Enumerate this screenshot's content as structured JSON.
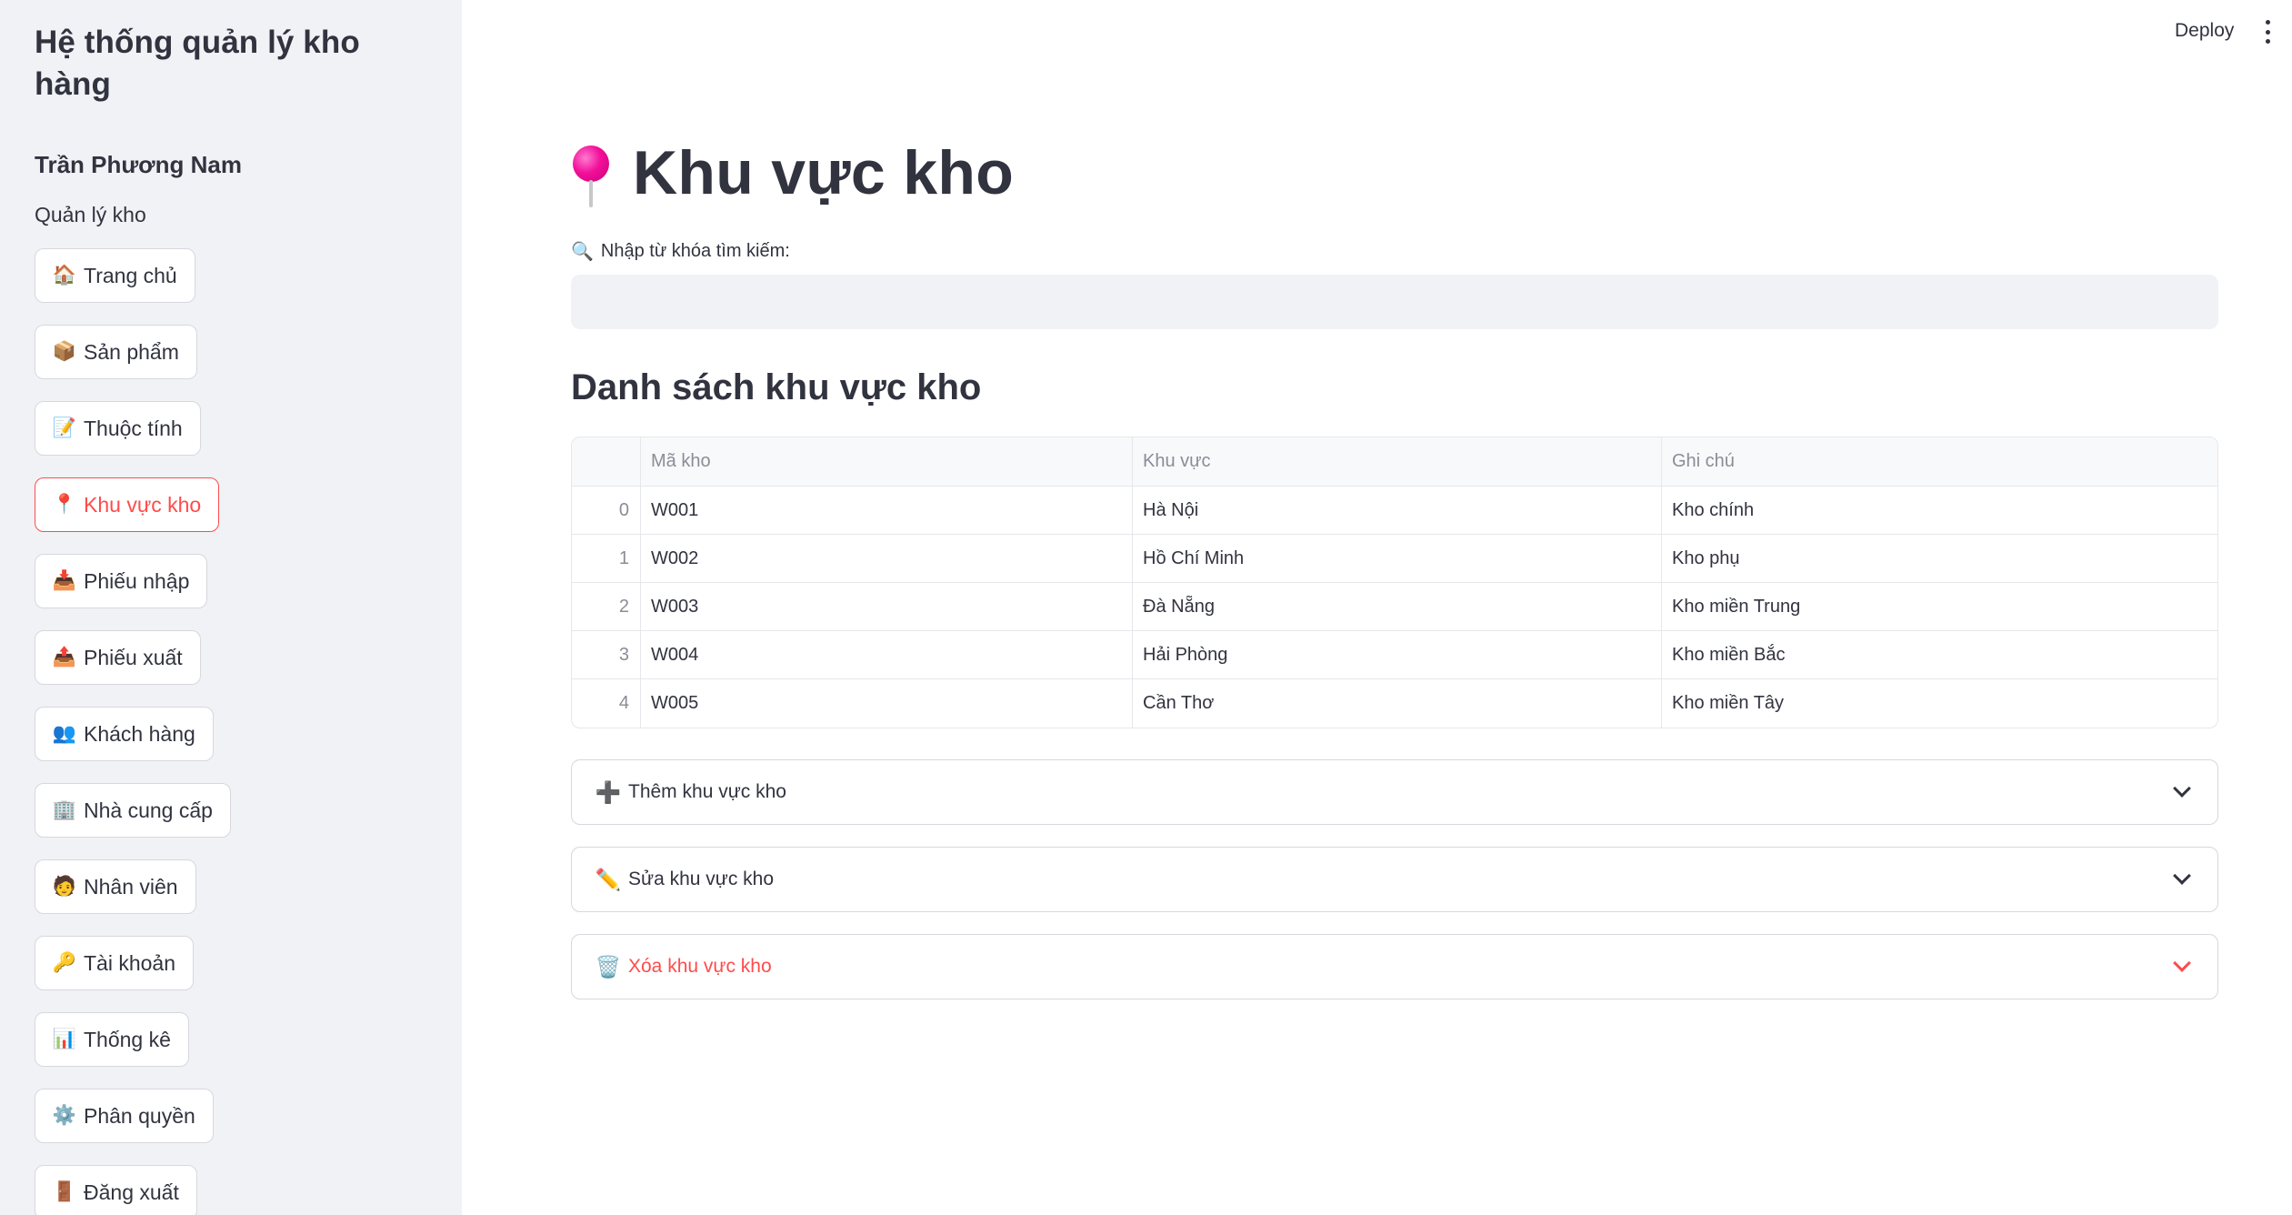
{
  "sidebar": {
    "app_title": "Hệ thống quản lý kho hàng",
    "user_name": "Trần Phương Nam",
    "section_label": "Quản lý kho",
    "items": [
      {
        "icon": "house-icon",
        "emoji": "🏠",
        "label": "Trang chủ"
      },
      {
        "icon": "package-icon",
        "emoji": "📦",
        "label": "Sản phẩm"
      },
      {
        "icon": "memo-icon",
        "emoji": "📝",
        "label": "Thuộc tính"
      },
      {
        "icon": "pushpin-icon",
        "emoji": "📍",
        "label": "Khu vực kho",
        "active": true
      },
      {
        "icon": "inbox-tray-icon",
        "emoji": "📥",
        "label": "Phiếu nhập"
      },
      {
        "icon": "outbox-tray-icon",
        "emoji": "📤",
        "label": "Phiếu xuất"
      },
      {
        "icon": "people-icon",
        "emoji": "👥",
        "label": "Khách hàng"
      },
      {
        "icon": "office-building-icon",
        "emoji": "🏢",
        "label": "Nhà cung cấp"
      },
      {
        "icon": "person-icon",
        "emoji": "🧑",
        "label": "Nhân viên"
      },
      {
        "icon": "key-icon",
        "emoji": "🔑",
        "label": "Tài khoản"
      },
      {
        "icon": "bar-chart-icon",
        "emoji": "📊",
        "label": "Thống kê"
      },
      {
        "icon": "gear-icon",
        "emoji": "⚙️",
        "label": "Phân quyền"
      },
      {
        "icon": "door-icon",
        "emoji": "🚪",
        "label": "Đăng xuất"
      }
    ]
  },
  "header": {
    "deploy_label": "Deploy"
  },
  "main": {
    "title": "Khu vực kho",
    "search": {
      "label": "Nhập từ khóa tìm kiếm:",
      "value": "",
      "placeholder": ""
    },
    "section_title": "Danh sách khu vực kho",
    "table": {
      "columns": [
        "Mã kho",
        "Khu vực",
        "Ghi chú"
      ],
      "rows": [
        {
          "index": "0",
          "ma_kho": "W001",
          "khu_vuc": "Hà Nội",
          "ghi_chu": "Kho chính"
        },
        {
          "index": "1",
          "ma_kho": "W002",
          "khu_vuc": "Hồ Chí Minh",
          "ghi_chu": "Kho phụ"
        },
        {
          "index": "2",
          "ma_kho": "W003",
          "khu_vuc": "Đà Nẵng",
          "ghi_chu": "Kho miền Trung"
        },
        {
          "index": "3",
          "ma_kho": "W004",
          "khu_vuc": "Hải Phòng",
          "ghi_chu": "Kho miền Bắc"
        },
        {
          "index": "4",
          "ma_kho": "W005",
          "khu_vuc": "Cần Thơ",
          "ghi_chu": "Kho miền Tây"
        }
      ]
    },
    "expanders": {
      "add": {
        "icon": "plus-icon",
        "label": "Thêm khu vực kho"
      },
      "edit": {
        "icon": "pencil-icon",
        "label": "Sửa khu vực kho"
      },
      "delete": {
        "icon": "wastebasket-icon",
        "label": "Xóa khu vực kho"
      }
    }
  },
  "colors": {
    "accent": "#ff4b4b",
    "sidebar_bg": "#f0f2f6",
    "text": "#31333f"
  }
}
